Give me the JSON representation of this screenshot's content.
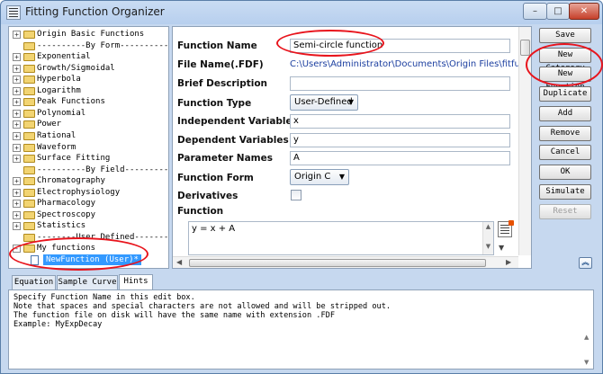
{
  "window": {
    "title": "Fitting Function Organizer",
    "controls": {
      "minimize": "–",
      "maximize": "□",
      "close": "✕"
    }
  },
  "tree": {
    "items": [
      {
        "label": "Origin Basic Functions",
        "expander": "+",
        "kind": "folder"
      },
      {
        "label": "----------By Form----------",
        "expander": "",
        "kind": "folder"
      },
      {
        "label": "Exponential",
        "expander": "+",
        "kind": "folder"
      },
      {
        "label": "Growth/Sigmoidal",
        "expander": "+",
        "kind": "folder"
      },
      {
        "label": "Hyperbola",
        "expander": "+",
        "kind": "folder"
      },
      {
        "label": "Logarithm",
        "expander": "+",
        "kind": "folder"
      },
      {
        "label": "Peak Functions",
        "expander": "+",
        "kind": "folder"
      },
      {
        "label": "Polynomial",
        "expander": "+",
        "kind": "folder"
      },
      {
        "label": "Power",
        "expander": "+",
        "kind": "folder"
      },
      {
        "label": "Rational",
        "expander": "+",
        "kind": "folder"
      },
      {
        "label": "Waveform",
        "expander": "+",
        "kind": "folder"
      },
      {
        "label": "Surface Fitting",
        "expander": "+",
        "kind": "folder"
      },
      {
        "label": "----------By Field---------",
        "expander": "",
        "kind": "folder"
      },
      {
        "label": "Chromatography",
        "expander": "+",
        "kind": "folder"
      },
      {
        "label": "Electrophysiology",
        "expander": "+",
        "kind": "folder"
      },
      {
        "label": "Pharmacology",
        "expander": "+",
        "kind": "folder"
      },
      {
        "label": "Spectroscopy",
        "expander": "+",
        "kind": "folder"
      },
      {
        "label": "Statistics",
        "expander": "+",
        "kind": "folder"
      },
      {
        "label": "--------User Defined-------",
        "expander": "",
        "kind": "folder"
      },
      {
        "label": "My functions",
        "expander": "-",
        "kind": "folder"
      },
      {
        "label": "NewFunction (User)*",
        "expander": "",
        "kind": "file",
        "selected": true
      }
    ]
  },
  "form": {
    "function_name": {
      "label": "Function Name",
      "value": "Semi-circle function"
    },
    "file_name": {
      "label": "File Name(.FDF)",
      "value": "C:\\Users\\Administrator\\Documents\\Origin Files\\fitfunc\\NewFun"
    },
    "brief_description": {
      "label": "Brief Description",
      "value": ""
    },
    "function_type": {
      "label": "Function Type",
      "value": "User-Defined"
    },
    "independent_variables": {
      "label": "Independent Variables",
      "value": "x"
    },
    "dependent_variables": {
      "label": "Dependent Variables",
      "value": "y"
    },
    "parameter_names": {
      "label": "Parameter Names",
      "value": "A"
    },
    "function_form": {
      "label": "Function Form",
      "value": "Origin C"
    },
    "derivatives": {
      "label": "Derivatives",
      "checked": false
    },
    "function": {
      "label": "Function",
      "value": "y = x + A"
    }
  },
  "buttons": {
    "save": "Save",
    "new_category": "New Category",
    "new_function": "New Function",
    "duplicate": "Duplicate",
    "add": "Add",
    "remove": "Remove",
    "cancel": "Cancel",
    "ok": "OK",
    "simulate": "Simulate",
    "reset": "Reset",
    "collapse": "︽"
  },
  "bottom_tabs": {
    "tabs": [
      "Equation",
      "Sample Curve",
      "Hints"
    ],
    "active": "Hints"
  },
  "hints": {
    "text": "Specify Function Name in this edit box.\nNote that spaces and special characters are not allowed and will be stripped out.\nThe function file on disk will have the same name with extension .FDF\nExample: MyExpDecay"
  },
  "colors": {
    "annotation_red": "#e8141c",
    "selection_blue": "#3399ff",
    "path_blue": "#1c3fa0"
  }
}
